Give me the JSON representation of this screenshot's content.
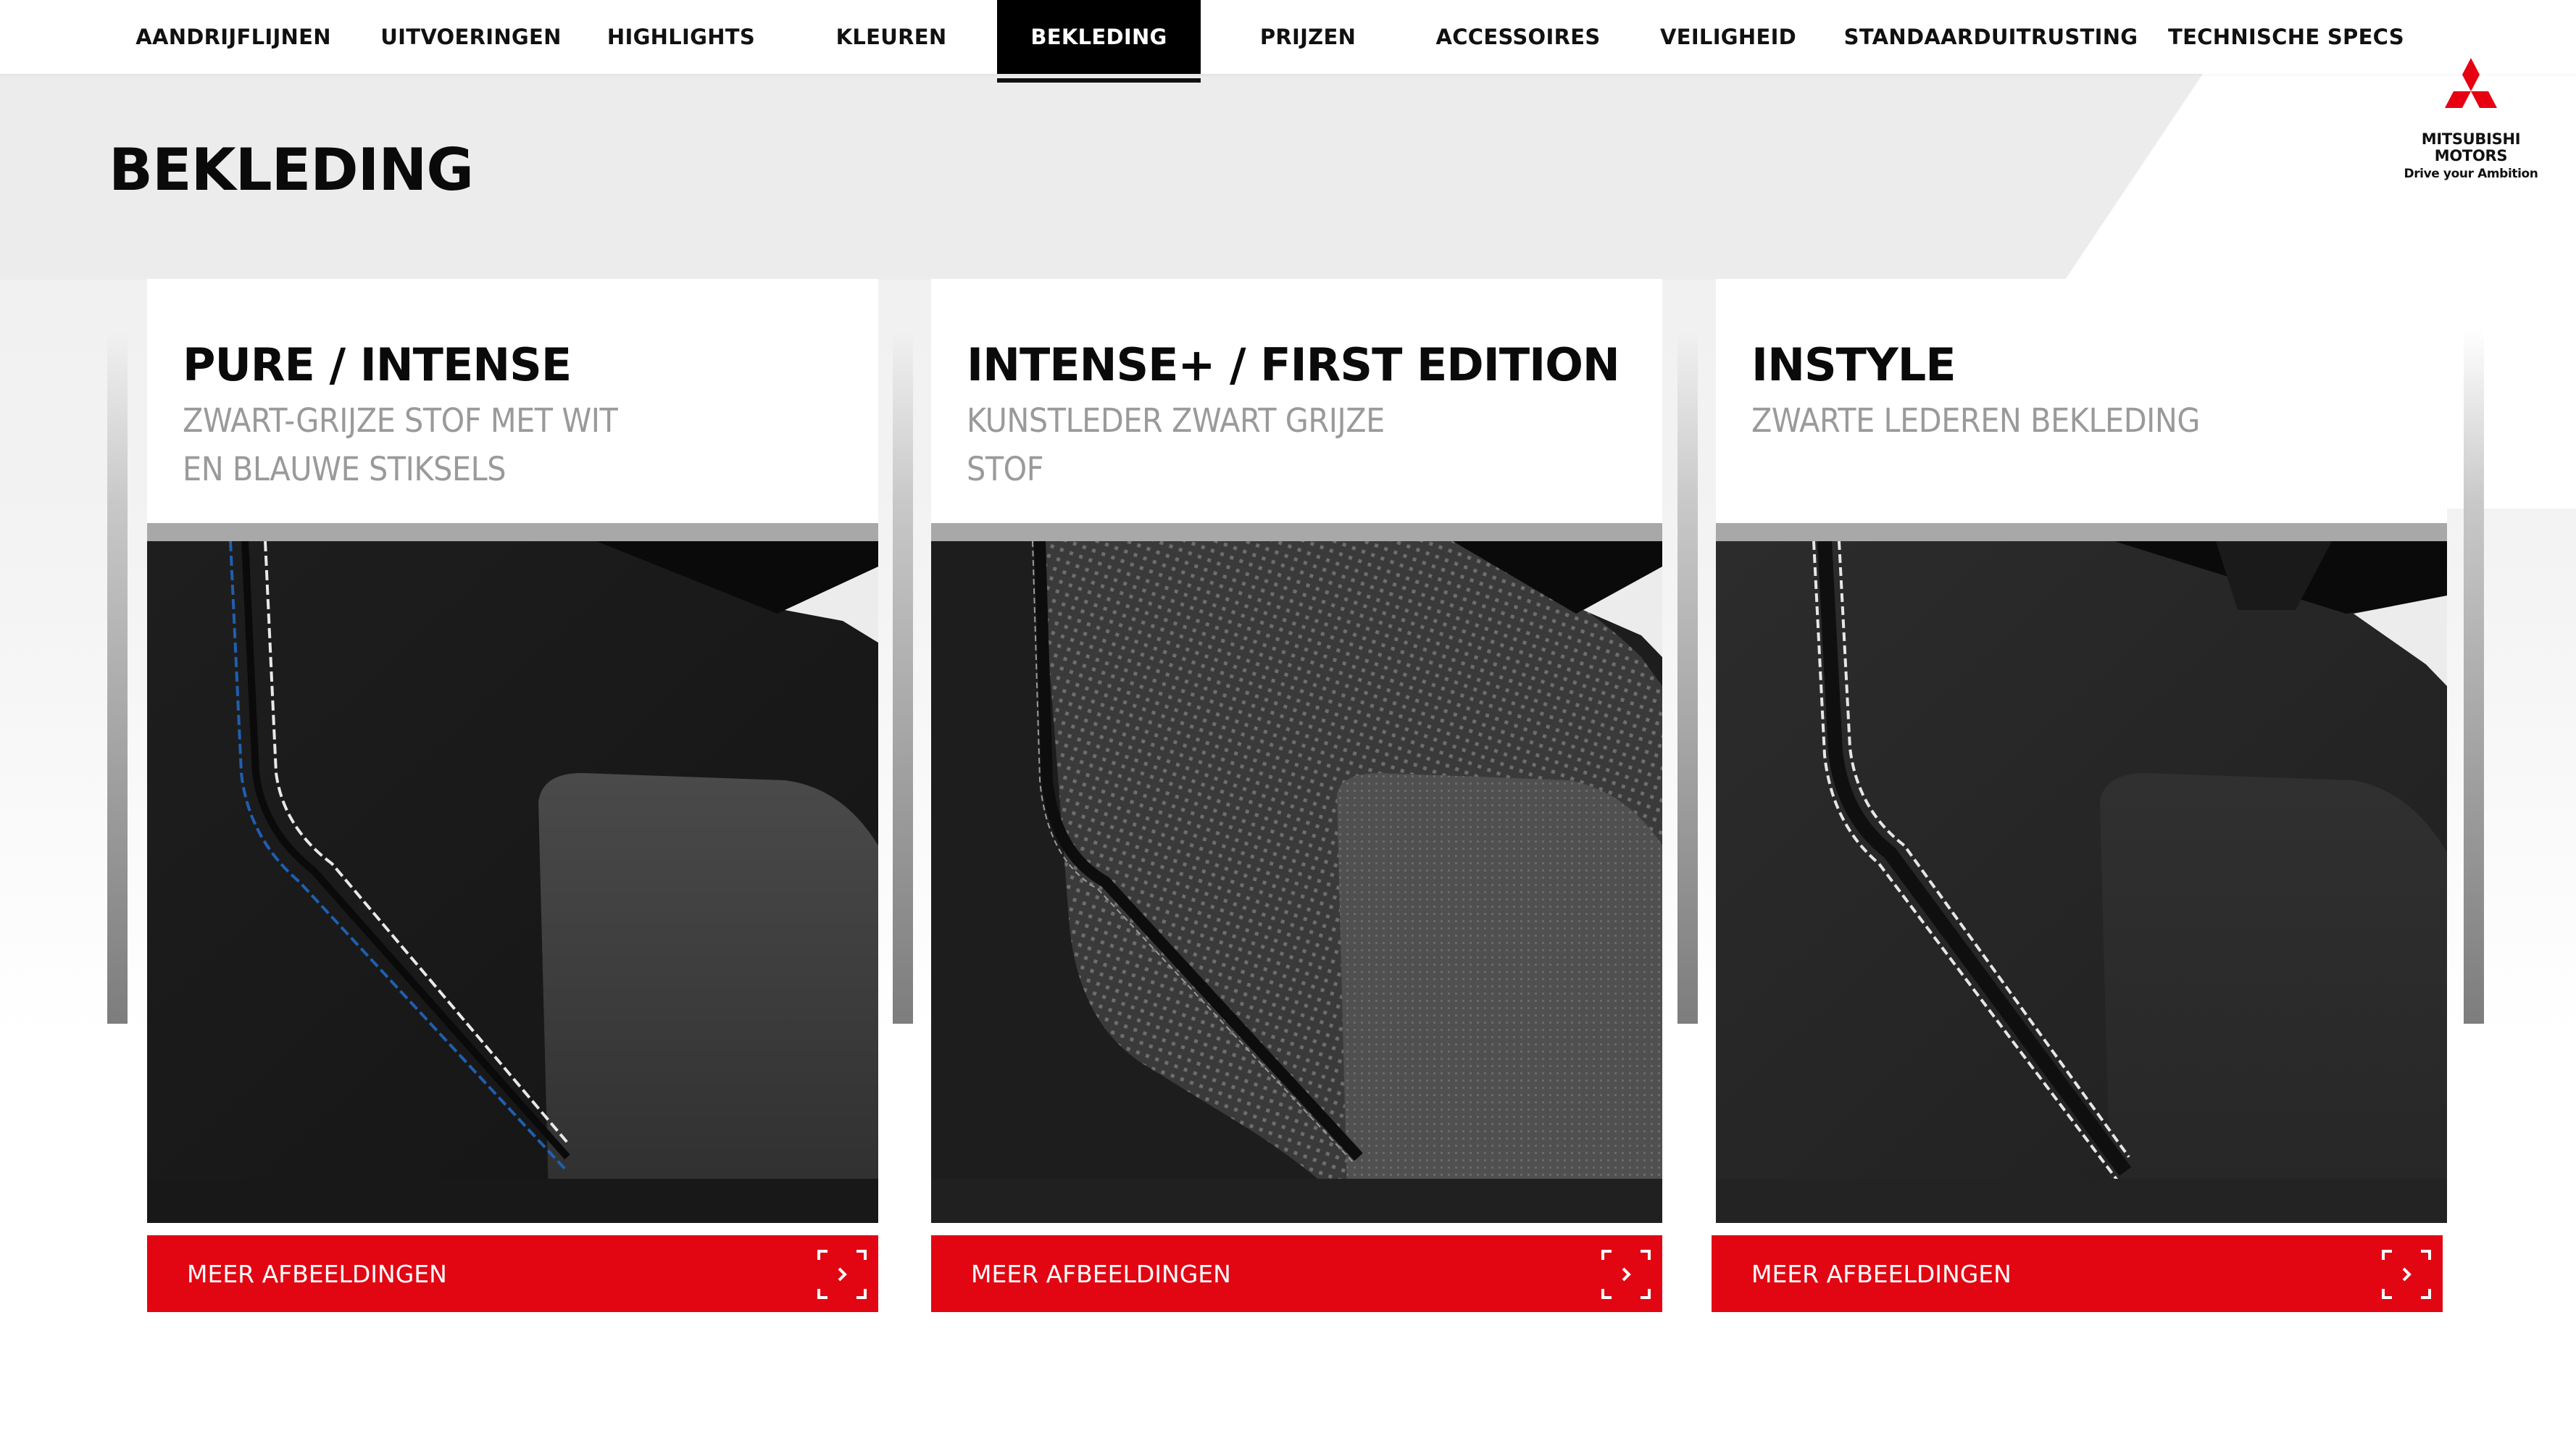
{
  "nav": {
    "items": [
      {
        "label": "AANDRIJFLIJNEN",
        "active": false
      },
      {
        "label": "UITVOERINGEN",
        "active": false
      },
      {
        "label": "HIGHLIGHTS",
        "active": false
      },
      {
        "label": "KLEUREN",
        "active": false
      },
      {
        "label": "BEKLEDING",
        "active": true
      },
      {
        "label": "PRIJZEN",
        "active": false
      },
      {
        "label": "ACCESSOIRES",
        "active": false
      },
      {
        "label": "VEILIGHEID",
        "active": false
      },
      {
        "label": "STANDAARDUITRUSTING",
        "active": false
      },
      {
        "label": "TECHNISCHE SPECS",
        "active": false
      }
    ]
  },
  "logo": {
    "icon": "three-diamonds-icon",
    "line1": "MITSUBISHI",
    "line2": "MOTORS",
    "tagline": "Drive your Ambition",
    "color": "#e60012"
  },
  "page": {
    "title": "BEKLEDING"
  },
  "cards": [
    {
      "title": "PURE / INTENSE",
      "subtitle": "ZWART-GRIJZE STOF MET WIT EN BLAUWE STIKSELS",
      "image": "seat-fabric-blue-white-stitching",
      "button_label": "MEER AFBEELDINGEN",
      "button_icon": "expand-arrow-icon"
    },
    {
      "title": "INTENSE+ / FIRST EDITION",
      "subtitle": "KUNSTLEDER ZWART GRIJZE STOF",
      "image": "seat-synthetic-leather-grey-fabric",
      "button_label": "MEER AFBEELDINGEN",
      "button_icon": "expand-arrow-icon"
    },
    {
      "title": "INSTYLE",
      "subtitle": "ZWARTE LEDEREN BEKLEDING",
      "image": "seat-black-leather-white-stitching",
      "button_label": "MEER AFBEELDINGEN",
      "button_icon": "expand-arrow-icon"
    }
  ],
  "colors": {
    "accent_red": "#e20613",
    "nav_active_bg": "#000000",
    "subtitle_grey": "#9a9a9a"
  }
}
